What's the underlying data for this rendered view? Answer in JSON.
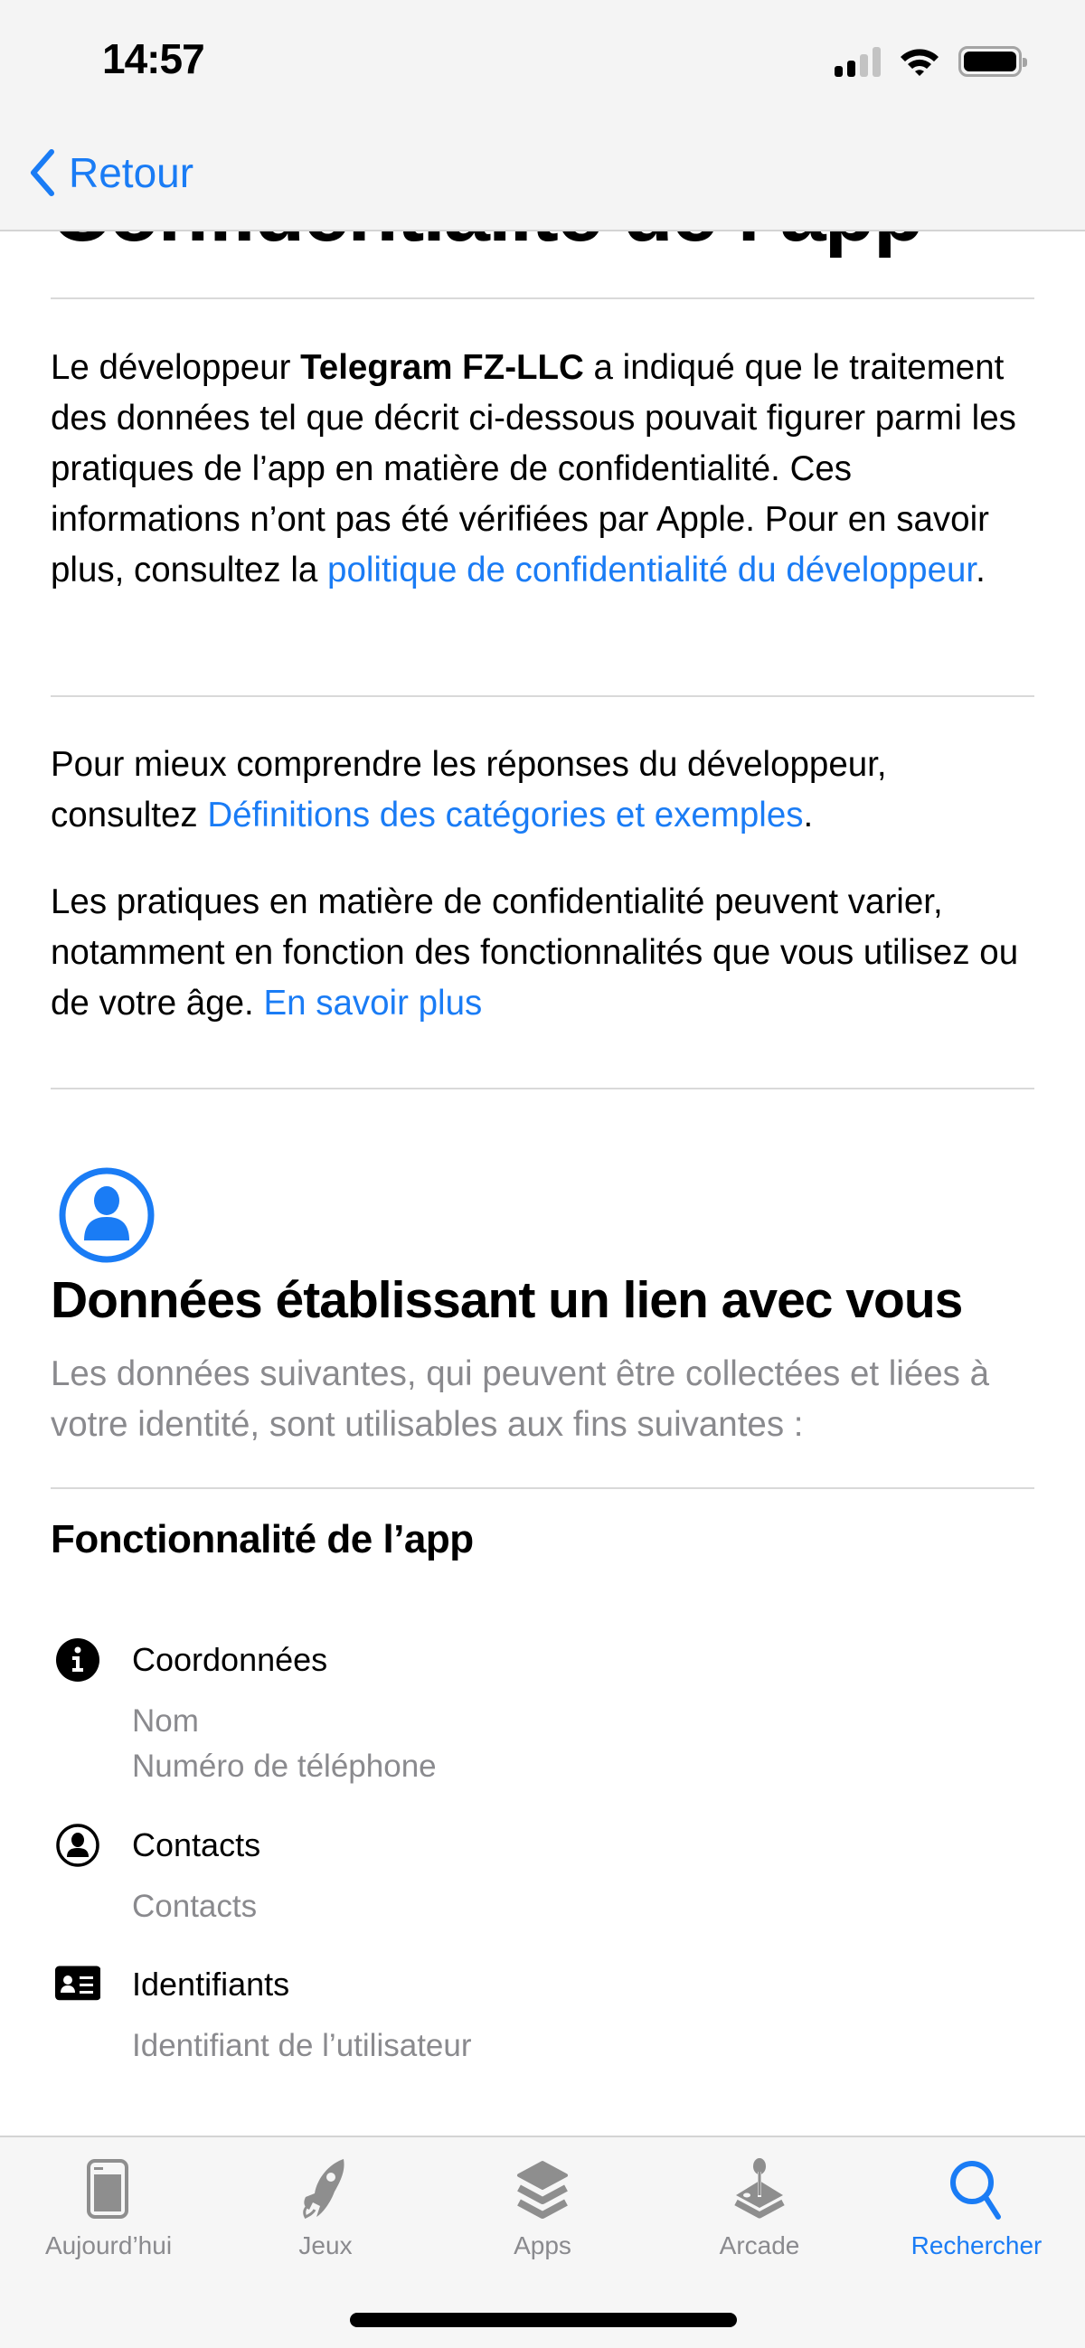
{
  "status_bar": {
    "time": "14:57",
    "signal_bars_active": 2,
    "signal_bars_total": 4,
    "battery_icon": "battery-full-icon",
    "wifi_icon": "wifi-icon"
  },
  "nav": {
    "back_label": "Retour",
    "back_icon": "chevron-left-icon"
  },
  "page": {
    "title": "Confidentialité de l’app",
    "intro": {
      "prefix": "Le développeur ",
      "developer": "Telegram FZ-LLC",
      "middle": " a indiqué que le traitement des données tel que décrit ci-dessous pouvait figurer parmi les pratiques de l’app en matière de confidentialité. Ces informations n’ont pas été vérifiées par Apple. Pour en savoir plus, consultez la ",
      "link": "politique de confidentialité du développeur",
      "suffix": "."
    },
    "definitions": {
      "prefix": "Pour mieux comprendre les réponses du développeur, consultez ",
      "link": "Définitions des catégories et exemples",
      "suffix": "."
    },
    "practices": {
      "text": "Les pratiques en matière de confidentialité peuvent varier, notamment en fonction des fonctionnalités que vous utilisez ou de votre âge. ",
      "link": "En savoir plus"
    }
  },
  "linked_data": {
    "icon": "person-circle-icon",
    "title": "Données établissant un lien avec vous",
    "subtitle": "Les données suivantes, qui peuvent être collectées et liées à votre identité, sont utilisables aux fins suivantes :",
    "categories": [
      {
        "title": "Fonctionnalité de l’app",
        "items": [
          {
            "icon": "info-circle-icon",
            "label": "Coordonnées",
            "details": [
              "Nom",
              "Numéro de téléphone"
            ]
          },
          {
            "icon": "person-circle-outline-icon",
            "label": "Contacts",
            "details": [
              "Contacts"
            ]
          },
          {
            "icon": "id-card-icon",
            "label": "Identifiants",
            "details": [
              "Identifiant de l’utilisateur"
            ]
          }
        ]
      }
    ]
  },
  "tabbar": {
    "active": "Rechercher",
    "tabs": [
      {
        "label": "Aujourd’hui",
        "icon": "today-icon"
      },
      {
        "label": "Jeux",
        "icon": "rocket-icon"
      },
      {
        "label": "Apps",
        "icon": "apps-stack-icon"
      },
      {
        "label": "Arcade",
        "icon": "joystick-icon"
      },
      {
        "label": "Rechercher",
        "icon": "search-icon"
      }
    ]
  },
  "colors": {
    "accent": "#1a7cf5",
    "secondary_text": "#8a8a8e",
    "tab_inactive": "#8e8e8e",
    "divider": "#d9d9d9"
  }
}
